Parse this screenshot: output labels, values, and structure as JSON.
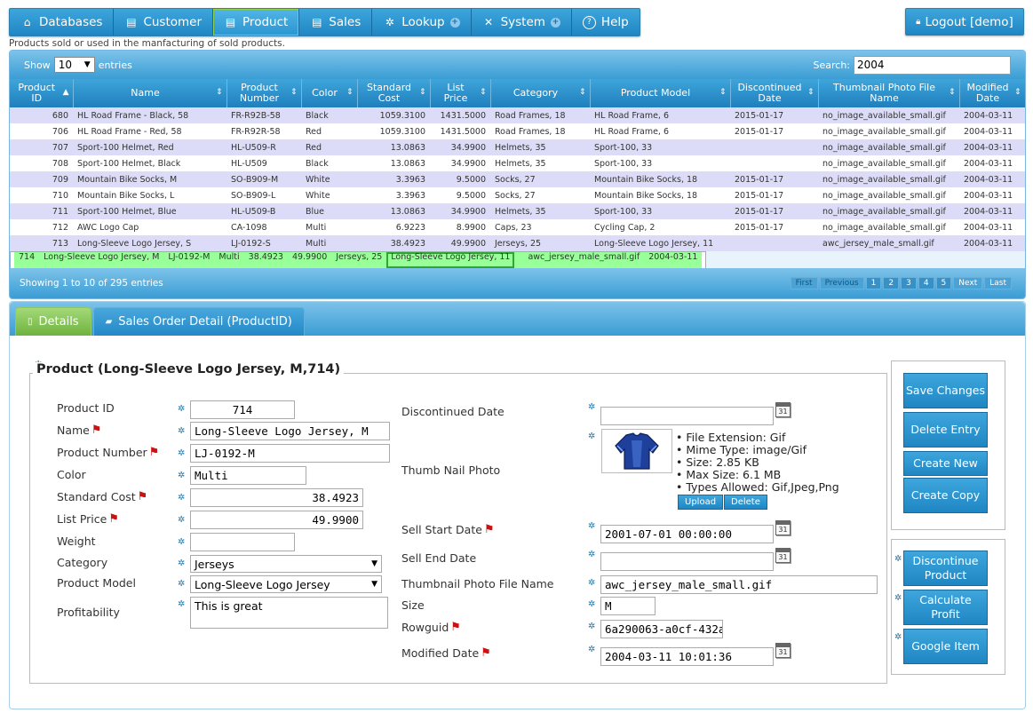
{
  "nav": {
    "items": [
      {
        "label": "Databases",
        "icon": "home-icon"
      },
      {
        "label": "Customer",
        "icon": "table-icon"
      },
      {
        "label": "Product",
        "icon": "table-icon"
      },
      {
        "label": "Sales",
        "icon": "table-icon"
      },
      {
        "label": "Lookup",
        "icon": "gear-icon"
      },
      {
        "label": "System",
        "icon": "tools-icon"
      },
      {
        "label": "Help",
        "icon": "help-icon"
      }
    ],
    "logout": "Logout [demo]"
  },
  "subtitle": "Products sold or used in the manfacturing of sold products.",
  "grid": {
    "show_label": "Show",
    "entries_label": "entries",
    "page_length": "10",
    "search_label": "Search:",
    "search_value": "2004",
    "columns": [
      "Product ID",
      "Name",
      "Product Number",
      "Color",
      "Standard Cost",
      "List Price",
      "Category",
      "Product Model",
      "Discontinued Date",
      "Thumbnail Photo File Name",
      "Modified Date"
    ],
    "rows": [
      [
        "680",
        "HL Road Frame - Black, 58",
        "FR-R92B-58",
        "Black",
        "1059.3100",
        "1431.5000",
        "Road Frames, 18",
        "HL Road Frame, 6",
        "2015-01-17",
        "no_image_available_small.gif",
        "2004-03-11"
      ],
      [
        "706",
        "HL Road Frame - Red, 58",
        "FR-R92R-58",
        "Red",
        "1059.3100",
        "1431.5000",
        "Road Frames, 18",
        "HL Road Frame, 6",
        "2015-01-17",
        "no_image_available_small.gif",
        "2004-03-11"
      ],
      [
        "707",
        "Sport-100 Helmet, Red",
        "HL-U509-R",
        "Red",
        "13.0863",
        "34.9900",
        "Helmets, 35",
        "Sport-100, 33",
        "",
        "no_image_available_small.gif",
        "2004-03-11"
      ],
      [
        "708",
        "Sport-100 Helmet, Black",
        "HL-U509",
        "Black",
        "13.0863",
        "34.9900",
        "Helmets, 35",
        "Sport-100, 33",
        "",
        "no_image_available_small.gif",
        "2004-03-11"
      ],
      [
        "709",
        "Mountain Bike Socks, M",
        "SO-B909-M",
        "White",
        "3.3963",
        "9.5000",
        "Socks, 27",
        "Mountain Bike Socks, 18",
        "2015-01-17",
        "no_image_available_small.gif",
        "2004-03-11"
      ],
      [
        "710",
        "Mountain Bike Socks, L",
        "SO-B909-L",
        "White",
        "3.3963",
        "9.5000",
        "Socks, 27",
        "Mountain Bike Socks, 18",
        "2015-01-17",
        "no_image_available_small.gif",
        "2004-03-11"
      ],
      [
        "711",
        "Sport-100 Helmet, Blue",
        "HL-U509-B",
        "Blue",
        "13.0863",
        "34.9900",
        "Helmets, 35",
        "Sport-100, 33",
        "2015-01-17",
        "no_image_available_small.gif",
        "2004-03-11"
      ],
      [
        "712",
        "AWC Logo Cap",
        "CA-1098",
        "Multi",
        "6.9223",
        "8.9900",
        "Caps, 23",
        "Cycling Cap, 2",
        "2015-01-17",
        "no_image_available_small.gif",
        "2004-03-11"
      ],
      [
        "713",
        "Long-Sleeve Logo Jersey, S",
        "LJ-0192-S",
        "Multi",
        "38.4923",
        "49.9900",
        "Jerseys, 25",
        "Long-Sleeve Logo Jersey, 11",
        "",
        "awc_jersey_male_small.gif",
        "2004-03-11"
      ],
      [
        "714",
        "Long-Sleeve Logo Jersey, M",
        "LJ-0192-M",
        "Multi",
        "38.4923",
        "49.9900",
        "Jerseys, 25",
        "Long-Sleeve Logo Jersey, 11",
        "",
        "awc_jersey_male_small.gif",
        "2004-03-11"
      ]
    ],
    "info": "Showing 1 to 10 of 295 entries",
    "pager": [
      "First",
      "Previous",
      "1",
      "2",
      "3",
      "4",
      "5",
      "Next",
      "Last"
    ]
  },
  "tabs": [
    "Details",
    "Sales Order Detail (ProductID)"
  ],
  "detail": {
    "legend": "Product (Long-Sleeve Logo Jersey, M,714)",
    "labels": {
      "product_id": "Product ID",
      "name": "Name",
      "product_number": "Product Number",
      "color": "Color",
      "standard_cost": "Standard Cost",
      "list_price": "List Price",
      "weight": "Weight",
      "category": "Category",
      "product_model": "Product Model",
      "profitability": "Profitability",
      "discontinued_date": "Discontinued Date",
      "thumb_nail_photo": "Thumb Nail Photo",
      "sell_start_date": "Sell Start Date",
      "sell_end_date": "Sell End Date",
      "thumbnail_file_name": "Thumbnail Photo File Name",
      "size": "Size",
      "rowguid": "Rowguid",
      "modified_date": "Modified Date"
    },
    "values": {
      "product_id": "714",
      "name": "Long-Sleeve Logo Jersey, M",
      "product_number": "LJ-0192-M",
      "color": "Multi",
      "standard_cost": "38.4923",
      "list_price": "49.9900",
      "weight": "",
      "category": "Jerseys",
      "product_model": "Long-Sleeve Logo Jersey",
      "profitability": "This is great",
      "discontinued_date": "",
      "sell_start_date": "2001-07-01 00:00:00",
      "sell_end_date": "",
      "thumbnail_file_name": "awc_jersey_male_small.gif",
      "size": "M",
      "rowguid": "6a290063-a0cf-432a",
      "modified_date": "2004-03-11 10:01:36"
    },
    "file_info": [
      "File Extension: Gif",
      "Mime Type: image/Gif",
      "Size: 2.85 KB",
      "Max Size: 6.1 MB",
      "Types Allowed: Gif,Jpeg,Png"
    ],
    "upload": "Upload",
    "delete": "Delete",
    "calendar_day": "31"
  },
  "actions": {
    "save": "Save Changes",
    "delete": "Delete Entry",
    "create_new": "Create New",
    "create_copy": "Create Copy",
    "discontinue": "Discontinue Product",
    "calculate": "Calculate Profit",
    "google": "Google Item"
  }
}
